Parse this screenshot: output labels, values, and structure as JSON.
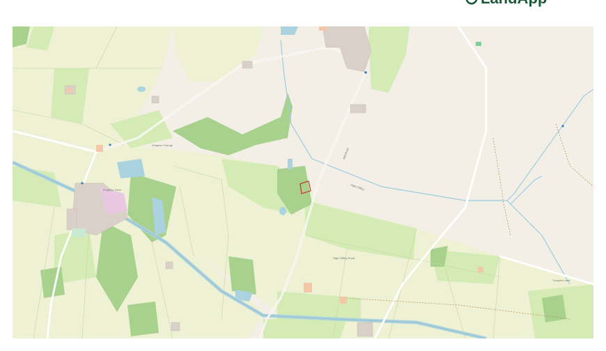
{
  "header": {
    "logo_text": "LandApp",
    "logo_icon": "landapp-leaf-icon",
    "brand_color": "#1d5a3a"
  },
  "map": {
    "colors": {
      "background": "#f3efe6",
      "farmland": "#eef1d4",
      "meadow": "#d5ebb5",
      "woodland": "#a9d18e",
      "water": "#aad3df",
      "road": "#ffffff",
      "parcel_outline": "#c0392b"
    },
    "road_labels": [
      {
        "text": "High Cliffey Road"
      },
      {
        "text": "High Cliffey"
      },
      {
        "text": "Turnpike Lane"
      },
      {
        "text": "Mill Road"
      }
    ],
    "place_labels": [
      {
        "text": "Kingston Grange"
      },
      {
        "text": "Kingston Farm"
      }
    ]
  }
}
